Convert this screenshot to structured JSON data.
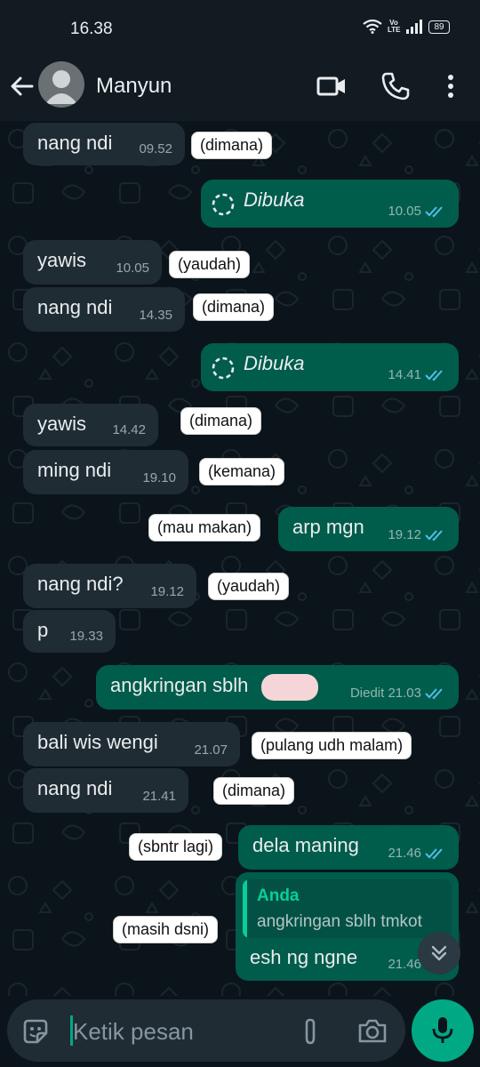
{
  "status": {
    "time": "16.38",
    "volte": "Vo LTE",
    "battery": "89"
  },
  "header": {
    "contact_name": "Manyun"
  },
  "messages": [
    {
      "dir": "in",
      "text": "nang ndi",
      "time": "09.52",
      "note": "(dimana)"
    },
    {
      "dir": "out",
      "text": "Dibuka",
      "time": "10.05",
      "view_once": true
    },
    {
      "dir": "in",
      "text": "yawis",
      "time": "10.05",
      "note": "(yaudah)"
    },
    {
      "dir": "in",
      "text": "nang ndi",
      "time": "14.35",
      "note": "(dimana)"
    },
    {
      "dir": "out",
      "text": "Dibuka",
      "time": "14.41",
      "view_once": true
    },
    {
      "dir": "in",
      "text": "yawis",
      "time": "14.42",
      "note": "(dimana)"
    },
    {
      "dir": "in",
      "text": "ming ndi",
      "time": "19.10",
      "note": "(kemana)"
    },
    {
      "dir": "out",
      "text": "arp mgn",
      "time": "19.12",
      "note": "(mau makan)"
    },
    {
      "dir": "in",
      "text": "nang ndi?",
      "time": "19.12",
      "note": "(yaudah)"
    },
    {
      "dir": "in",
      "text": "p",
      "time": "19.33"
    },
    {
      "dir": "out",
      "text": "angkringan sblh",
      "time": "Diedit 21.03",
      "edited": true
    },
    {
      "dir": "in",
      "text": "bali wis wengi",
      "time": "21.07",
      "note": "(pulang udh malam)"
    },
    {
      "dir": "in",
      "text": "nang ndi",
      "time": "21.41",
      "note": "(dimana)"
    },
    {
      "dir": "out",
      "text": "dela maning",
      "time": "21.46",
      "note": "(sbntr lagi)"
    },
    {
      "dir": "out",
      "text": "esh ng ngne",
      "time": "21.46",
      "note": "(masih dsni)",
      "quote": {
        "author": "Anda",
        "text": "angkringan sblh tmkot"
      }
    }
  ],
  "input": {
    "placeholder": "Ketik pesan"
  },
  "icons": [
    "back-arrow-icon",
    "video-call-icon",
    "phone-icon",
    "more-vert-icon",
    "sticker-icon",
    "attach-icon",
    "camera-icon",
    "mic-icon",
    "double-check-icon",
    "view-once-icon",
    "double-chevron-down-icon"
  ],
  "colors": {
    "incoming": "#202c33",
    "outgoing": "#005c4b",
    "accent": "#00a884",
    "read_ticks": "#53bdeb"
  }
}
